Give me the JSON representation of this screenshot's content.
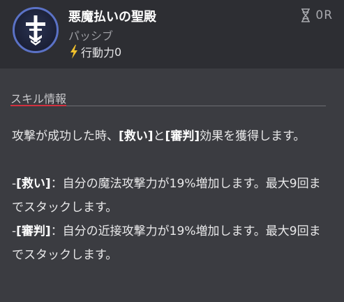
{
  "skill": {
    "icon": "holy-cross-icon",
    "name": "悪魔払いの聖殿",
    "type": "パッシブ",
    "action_label": "行動力",
    "action_value": "0",
    "cooldown_value": "0",
    "cooldown_unit": "R"
  },
  "section": {
    "title": "スキル情報",
    "accent_color": "#d2313f"
  },
  "description": {
    "intro": {
      "pre": "攻撃が成功した時、",
      "tag1": "[救い]",
      "mid": "と",
      "tag2": "[審判]",
      "post": "効果を獲得します。"
    },
    "effect1": {
      "dash": "-",
      "tag": "[救い]",
      "text": "：自分の魔法攻撃力が19%増加します。最大9回までスタックします。"
    },
    "effect2": {
      "dash": "-",
      "tag": "[審判]",
      "text": "：自分の近接攻撃力が19%増加します。最大9回までスタックします。"
    }
  }
}
